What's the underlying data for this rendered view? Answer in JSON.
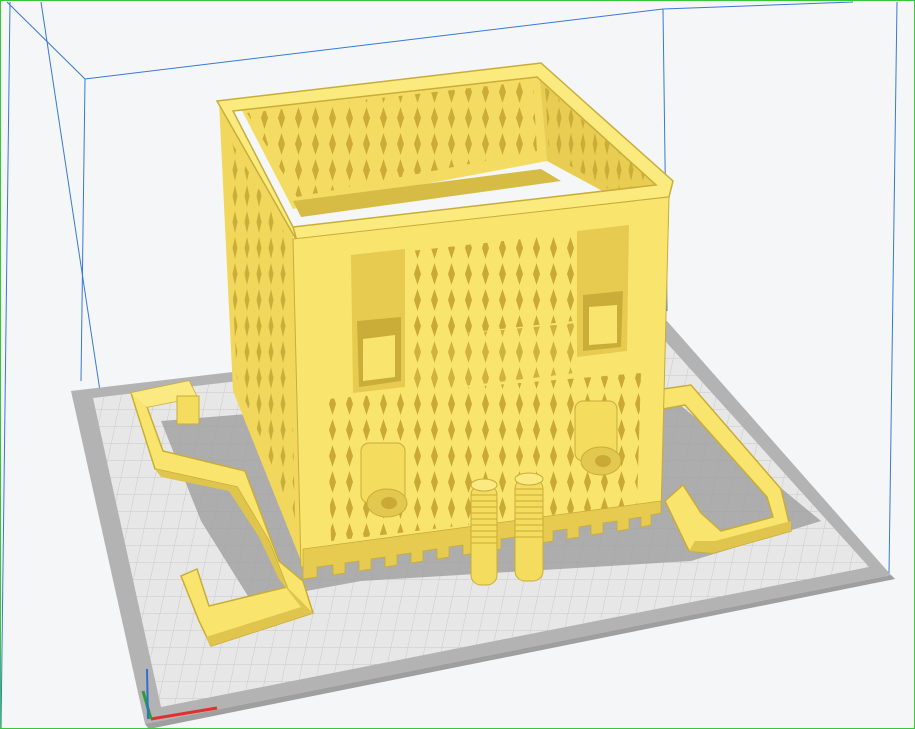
{
  "viewport": {
    "kind": "3d-print-preview",
    "background": "#f4f6f7",
    "frame_color": "#37c837"
  },
  "build_volume": {
    "edge_color": "#3a78d6"
  },
  "build_plate": {
    "base_color": "#e6e6e6",
    "grid_color": "#c8c8c8",
    "border_color": "#a8a8a8",
    "shadow_color": "#9a9a9a"
  },
  "model": {
    "color": "#f9e56e",
    "shade_color": "#dfc54d",
    "dark_color": "#c9ad38",
    "cut_color": "#8a7a22"
  },
  "axes": {
    "x_color": "#e03030",
    "y_color": "#2e9e2e",
    "z_color": "#2d6fd6"
  }
}
